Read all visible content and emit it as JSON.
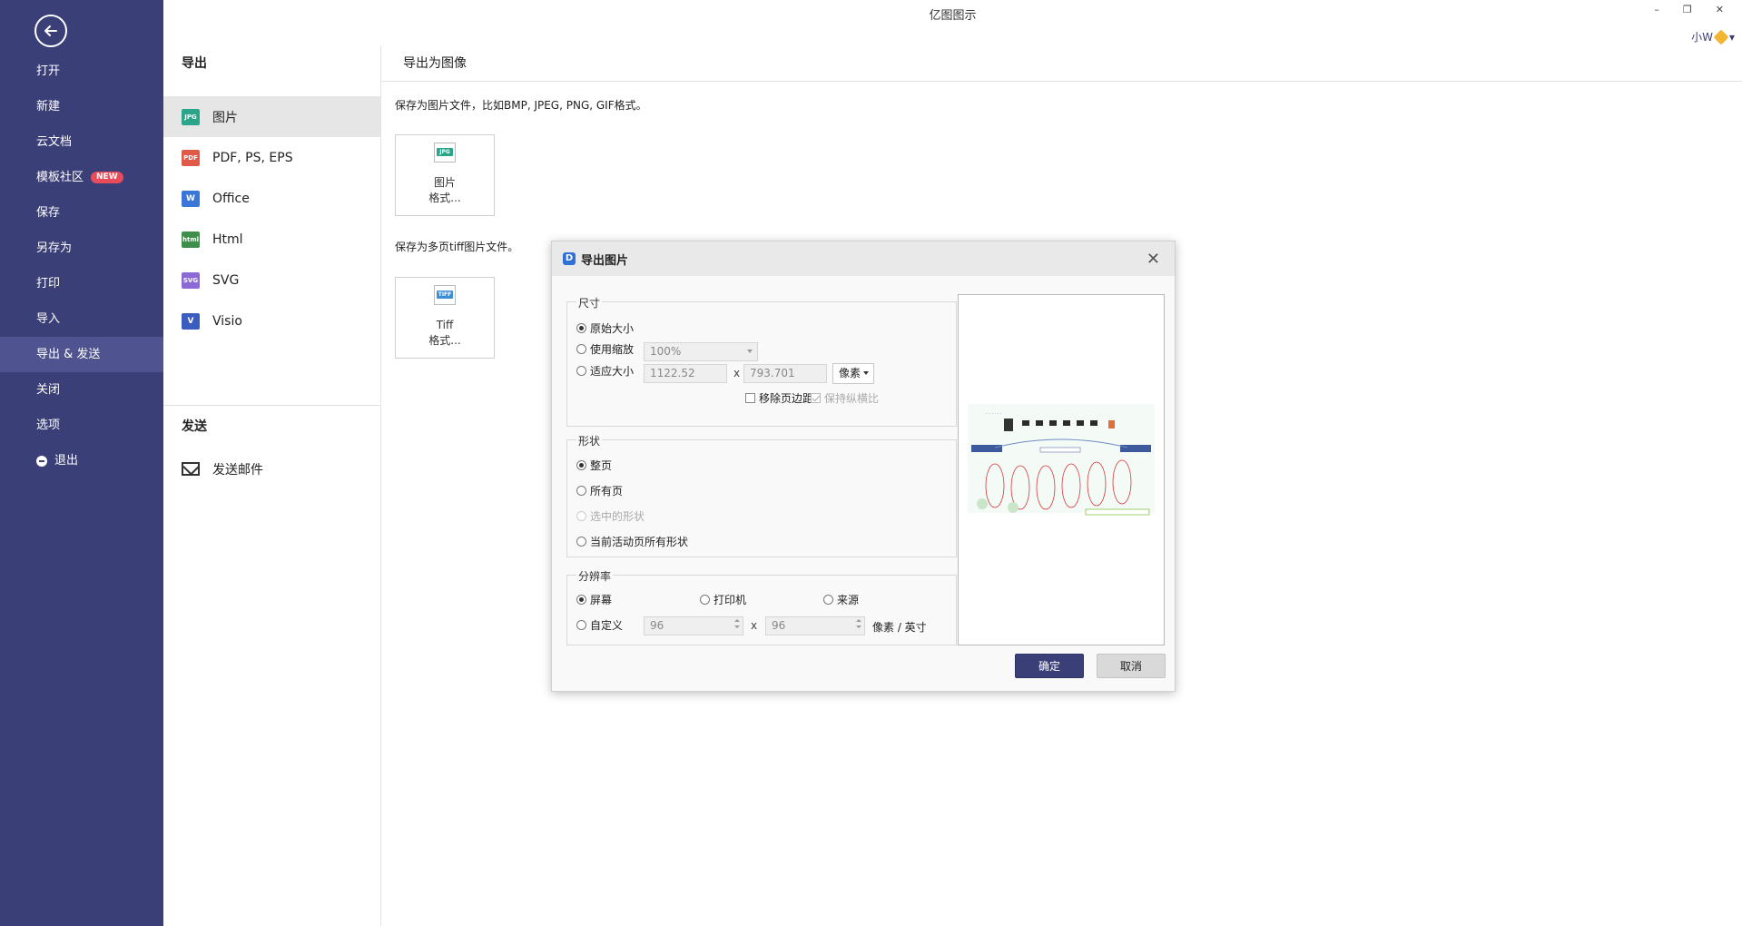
{
  "window": {
    "title": "亿图图示",
    "minimize": "–",
    "restore": "❐",
    "close": "✕"
  },
  "user": {
    "name": "小W",
    "dropdown": "▾"
  },
  "sidebar": {
    "items": [
      {
        "label": "打开"
      },
      {
        "label": "新建"
      },
      {
        "label": "云文档"
      },
      {
        "label": "模板社区",
        "badge": "NEW"
      },
      {
        "label": "保存"
      },
      {
        "label": "另存为"
      },
      {
        "label": "打印"
      },
      {
        "label": "导入"
      },
      {
        "label": "导出 & 发送"
      },
      {
        "label": "关闭"
      },
      {
        "label": "选项"
      },
      {
        "label": "退出"
      }
    ]
  },
  "middle": {
    "export_title": "导出",
    "export_items": [
      {
        "label": "图片",
        "tag": "JPG"
      },
      {
        "label": "PDF, PS, EPS",
        "tag": "PDF"
      },
      {
        "label": "Office",
        "tag": "W"
      },
      {
        "label": "Html",
        "tag": "html"
      },
      {
        "label": "SVG",
        "tag": "SVG"
      },
      {
        "label": "Visio",
        "tag": "V"
      }
    ],
    "send_title": "发送",
    "send_items": [
      {
        "label": "发送邮件"
      }
    ]
  },
  "content": {
    "header": "导出为图像",
    "desc_image": "保存为图片文件，比如BMP, JPEG, PNG, GIF格式。",
    "tile_image": {
      "tag": "JPG",
      "line1": "图片",
      "line2": "格式..."
    },
    "desc_tiff": "保存为多页tiff图片文件。",
    "tile_tiff": {
      "tag": "TIFF",
      "line1": "Tiff",
      "line2": "格式..."
    }
  },
  "dialog": {
    "title": "导出图片",
    "logo": "D",
    "close": "✕",
    "size": {
      "title": "尺寸",
      "original": "原始大小",
      "zoom": "使用缩放",
      "zoom_value": "100%",
      "fit": "适应大小",
      "width": "1122.52",
      "height": "793.701",
      "x": "x",
      "unit": "像素",
      "remove_margin": "移除页边距",
      "keep_ratio": "保持纵横比"
    },
    "shape": {
      "title": "形状",
      "whole_page": "整页",
      "all_pages": "所有页",
      "selected": "选中的形状",
      "current_all": "当前活动页所有形状"
    },
    "resolution": {
      "title": "分辨率",
      "screen": "屏幕",
      "printer": "打印机",
      "source": "来源",
      "custom": "自定义",
      "dpi_x": "96",
      "dpi_y": "96",
      "x": "x",
      "unit": "像素 / 英寸"
    },
    "ok": "确定",
    "cancel": "取消"
  },
  "colors": {
    "sidebar_bg": "#3b3f78",
    "sidebar_active": "#4f5390",
    "accent": "#3b3f78",
    "badge": "#e74c5a"
  }
}
